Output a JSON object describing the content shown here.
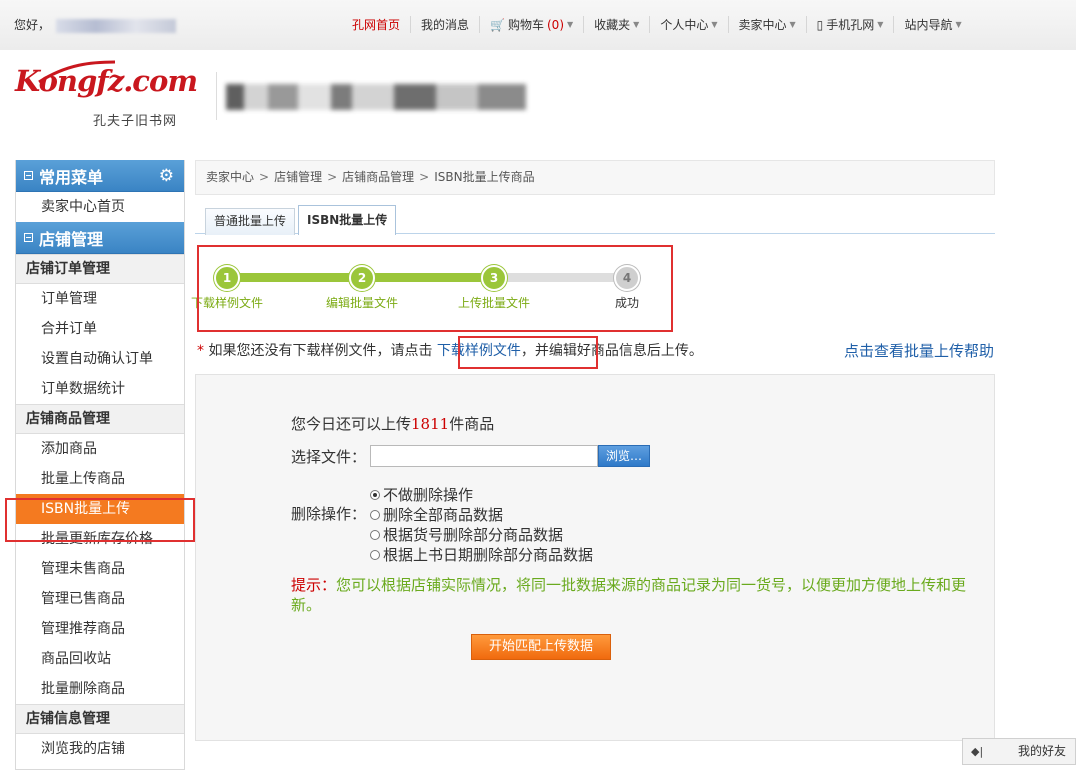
{
  "topbar": {
    "greeting": "您好，",
    "nav": [
      {
        "label": "孔网首页",
        "red": true,
        "caret": false,
        "icon": ""
      },
      {
        "label": "我的消息",
        "red": false,
        "caret": false,
        "icon": ""
      },
      {
        "label": "购物车",
        "red": false,
        "caret": true,
        "icon": "cart-icon",
        "count": "(0)"
      },
      {
        "label": "收藏夹",
        "red": false,
        "caret": true,
        "icon": ""
      },
      {
        "label": "个人中心",
        "red": false,
        "caret": true,
        "icon": ""
      },
      {
        "label": "卖家中心",
        "red": false,
        "caret": true,
        "icon": ""
      },
      {
        "label": "手机孔网",
        "red": false,
        "caret": true,
        "icon": "phone-icon"
      },
      {
        "label": "站内导航",
        "red": false,
        "caret": true,
        "icon": ""
      }
    ]
  },
  "logo": {
    "text": "Kongfz.com",
    "subtitle": "孔夫子旧书网"
  },
  "sidebar": {
    "common_menu_title": "常用菜单",
    "common_items": [
      "卖家中心首页"
    ],
    "shop_title": "店铺管理",
    "groups": [
      {
        "title": "店铺订单管理",
        "items": [
          "订单管理",
          "合并订单",
          "设置自动确认订单",
          "订单数据统计"
        ]
      },
      {
        "title": "店铺商品管理",
        "items": [
          "添加商品",
          "批量上传商品",
          "ISBN批量上传",
          "批量更新库存价格",
          "管理未售商品",
          "管理已售商品",
          "管理推荐商品",
          "商品回收站",
          "批量删除商品"
        ]
      },
      {
        "title": "店铺信息管理",
        "items": [
          "浏览我的店铺"
        ]
      }
    ],
    "active_item": "ISBN批量上传"
  },
  "breadcrumb": [
    "卖家中心",
    "店铺管理",
    "店铺商品管理",
    "ISBN批量上传商品"
  ],
  "tabs": [
    {
      "label": "普通批量上传",
      "selected": false
    },
    {
      "label": "ISBN批量上传",
      "selected": true
    }
  ],
  "steps": [
    {
      "num": "1",
      "label": "下载样例文件",
      "done": true
    },
    {
      "num": "2",
      "label": "编辑批量文件",
      "done": true
    },
    {
      "num": "3",
      "label": "上传批量文件",
      "done": true
    },
    {
      "num": "4",
      "label": "成功",
      "done": false
    }
  ],
  "hint": {
    "star": "*",
    "before": " 如果您还没有下载样例文件，请点击 ",
    "link": "下载样例文件",
    "after": "，并编辑好商品信息后上传。"
  },
  "help_link": "点击查看批量上传帮助",
  "form": {
    "quota_before": "您今日还可以上传",
    "quota_num": "1811",
    "quota_after": "件商品",
    "file_label": "选择文件：",
    "file_value": "",
    "browse_label": "浏览…",
    "delete_label": "删除操作：",
    "delete_options": [
      {
        "label": "不做删除操作",
        "checked": true
      },
      {
        "label": "删除全部商品数据",
        "checked": false
      },
      {
        "label": "根据货号删除部分商品数据",
        "checked": false
      },
      {
        "label": "根据上书日期删除部分商品数据",
        "checked": false
      }
    ],
    "tip_label": "提示：",
    "tip_text": "您可以根据店铺实际情况，将同一批数据来源的商品记录为同一货号，以便更加方便地上传和更新。",
    "start_button": "开始匹配上传数据"
  },
  "friends": {
    "label": "我的好友",
    "icon": "collapse-icon"
  },
  "colors": {
    "accent": "#f47a20",
    "link": "#1f5fa8",
    "step_green": "#9bc63a",
    "highlight_red": "#e03030"
  }
}
